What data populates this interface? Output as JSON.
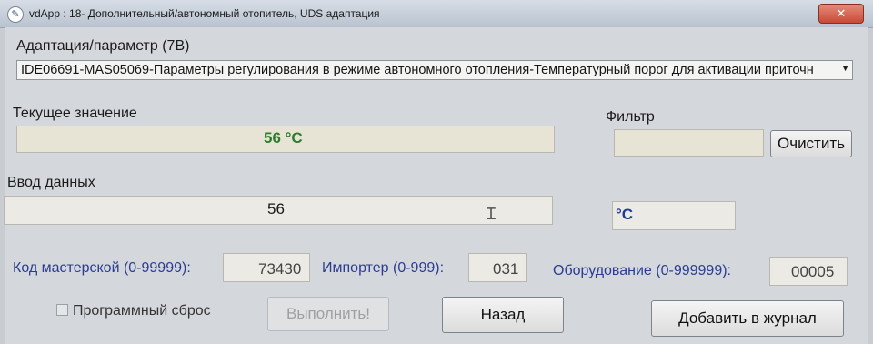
{
  "window": {
    "title": "vdApp : 18- Дополнительный/автономный отопитель, UDS адаптация",
    "close_label": "✕"
  },
  "adaptation": {
    "label": "Адаптация/параметр (7B)",
    "selected": "IDE06691-MAS05069-Параметры регулирования в режиме автономного отопления-Температурный порог для активации приточн"
  },
  "current_value": {
    "label": "Текущее значение",
    "value": "56 °C"
  },
  "filter": {
    "label": "Фильтр",
    "value": "",
    "clear_label": "Очистить"
  },
  "data_input": {
    "label": "Ввод данных",
    "value": "56",
    "unit": "°C"
  },
  "workshop_code": {
    "label": "Код мастерской (0-99999):",
    "value": "73430"
  },
  "importer": {
    "label": "Импортер (0-999):",
    "value": "031"
  },
  "equipment": {
    "label": "Оборудование (0-999999):",
    "value": "00005"
  },
  "actions": {
    "software_reset_label": "Программный сброс",
    "execute_label": "Выполнить!",
    "back_label": "Назад",
    "add_to_log_label": "Добавить в журнал"
  },
  "colors": {
    "current_value_text": "#2e7d2e",
    "label_blue": "#2a3d93",
    "unit_text": "#1f3a9a"
  }
}
